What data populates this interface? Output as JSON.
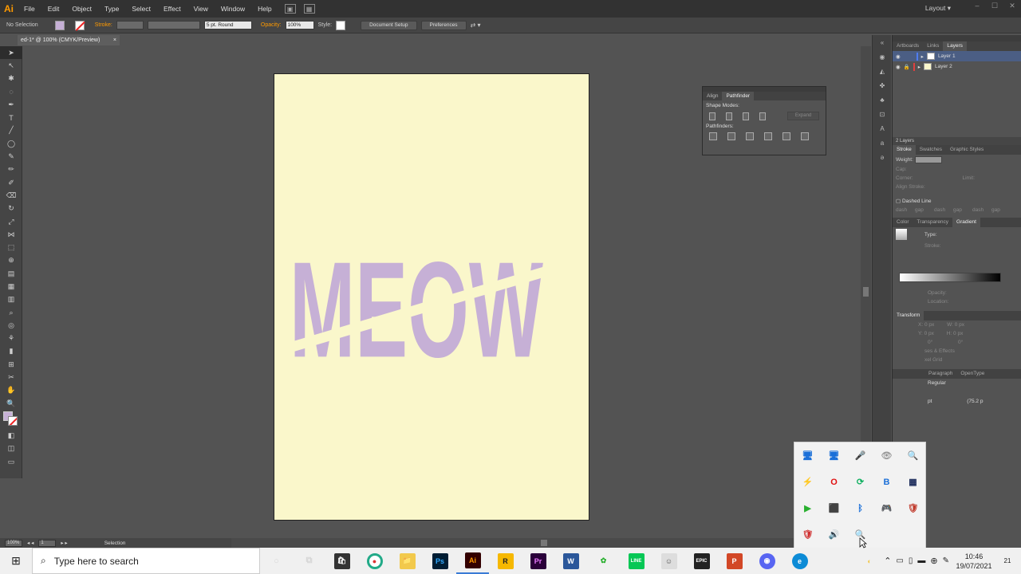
{
  "menubar": {
    "logo": "Ai",
    "items": [
      "File",
      "Edit",
      "Object",
      "Type",
      "Select",
      "Effect",
      "View",
      "Window",
      "Help"
    ],
    "workspace": "Layout",
    "window_controls": [
      "–",
      "☐",
      "✕"
    ]
  },
  "control_bar": {
    "selection": "No Selection",
    "stroke_label": "Stroke:",
    "brush_value": "5 pt. Round",
    "opacity_label": "Opacity:",
    "opacity_value": "100%",
    "style_label": "Style:",
    "document_setup": "Document Setup",
    "preferences": "Preferences",
    "fill_color": "#c6b0d6"
  },
  "document_tab": {
    "title": "ed-1* @ 100% (CMYK/Preview)",
    "close": "×"
  },
  "artwork": {
    "text": "MEOW",
    "text_color": "#c6b0d6",
    "artboard_color": "#faf7cb"
  },
  "status_bar": {
    "zoom": "100%",
    "page": "1",
    "tool": "Selection"
  },
  "pathfinder_panel": {
    "tabs": [
      "Align",
      "Pathfinder"
    ],
    "shape_modes": "Shape Modes:",
    "pathfinders": "Pathfinders:",
    "expand": "Expand"
  },
  "layers_panel": {
    "tabs": [
      "Artboards",
      "Links",
      "Layers"
    ],
    "layers": [
      {
        "name": "Layer 1",
        "color": "#4f7df0"
      },
      {
        "name": "Layer 2",
        "color": "#e04040"
      }
    ],
    "count": "2 Layers"
  },
  "stroke_panel": {
    "tabs": [
      "Stroke",
      "Swatches",
      "Graphic Styles"
    ],
    "weight": "Weight:",
    "cap": "Cap:",
    "corner": "Corner:",
    "limit": "Limit:",
    "align": "Align Stroke:",
    "dashed": "Dashed Line",
    "dash_labels": [
      "dash",
      "gap",
      "dash",
      "gap",
      "dash",
      "gap"
    ]
  },
  "gradient_panel": {
    "tabs": [
      "Color",
      "Transparency",
      "Gradient"
    ],
    "type": "Type:",
    "stroke": "Stroke:",
    "opacity": "Opacity:",
    "location": "Location:"
  },
  "transform_panel": {
    "title": "Transform",
    "x": "X:",
    "x_val": "0 px",
    "w": "W:",
    "w_val": "0 px",
    "y": "Y:",
    "y_val": "0 px",
    "h": "H:",
    "h_val": "0 px",
    "angle_val": "0°",
    "shear_val": "0°"
  },
  "appearance": {
    "line1": "ses & Effects",
    "line2": "xel Grid"
  },
  "char_panel": {
    "tabs": [
      "Paragraph",
      "OpenType"
    ],
    "style": "Regular",
    "size_unit": "pt",
    "leading": "(75.2 p"
  },
  "tray_popup": {
    "icons": [
      "🖥",
      "🖥",
      "🎤",
      "👁",
      "🔍",
      "⚡",
      "O",
      "⟳",
      "B",
      "▦",
      "▶",
      "⬛",
      "ᛒ",
      "🎮",
      "🛡",
      "🛡",
      "🔊",
      "🔍"
    ]
  },
  "taskbar": {
    "search_placeholder": "Type here to search",
    "apps": [
      {
        "icon": "○",
        "label": ""
      },
      {
        "icon": "⧉",
        "label": ""
      },
      {
        "icon": "🛍",
        "label": ""
      },
      {
        "icon": "●",
        "label": ""
      },
      {
        "icon": "📁",
        "label": ""
      },
      {
        "icon": "Ps",
        "label": "photoshop"
      },
      {
        "icon": "Ai",
        "label": "illustrator"
      },
      {
        "icon": "R",
        "label": "rockstar"
      },
      {
        "icon": "Pr",
        "label": "premiere"
      },
      {
        "icon": "W",
        "label": "word"
      },
      {
        "icon": "✿",
        "label": "sims"
      },
      {
        "icon": "LINE",
        "label": "line"
      },
      {
        "icon": "☺",
        "label": "game"
      },
      {
        "icon": "EPIC",
        "label": "epic"
      },
      {
        "icon": "P",
        "label": "powerpoint"
      },
      {
        "icon": "◉",
        "label": "discord"
      },
      {
        "icon": "e",
        "label": "edge"
      },
      {
        "icon": "◐",
        "label": "other"
      }
    ],
    "time": "10:46",
    "date": "19/07/2021",
    "notification_count": "21"
  }
}
